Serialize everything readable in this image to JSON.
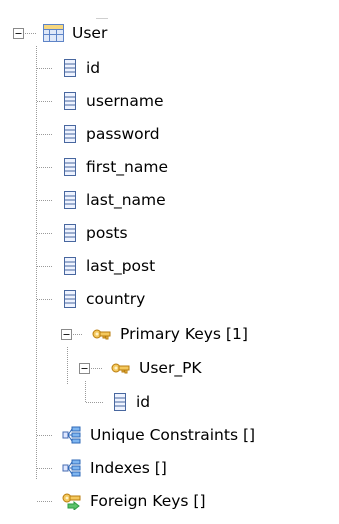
{
  "tree": {
    "table": {
      "label": "User",
      "icon": "table-grid-icon"
    },
    "columns": [
      {
        "label": "id",
        "icon": "column-icon"
      },
      {
        "label": "username",
        "icon": "column-icon"
      },
      {
        "label": "password",
        "icon": "column-icon"
      },
      {
        "label": "first_name",
        "icon": "column-icon"
      },
      {
        "label": "last_name",
        "icon": "column-icon"
      },
      {
        "label": "posts",
        "icon": "column-icon"
      },
      {
        "label": "last_post",
        "icon": "column-icon"
      },
      {
        "label": "country",
        "icon": "column-icon"
      }
    ],
    "primary_keys": {
      "label": "Primary Keys [1]",
      "icon": "key-icon",
      "child": {
        "label": "User_PK",
        "icon": "key-icon",
        "column": {
          "label": "id",
          "icon": "column-icon"
        }
      }
    },
    "unique_constraints": {
      "label": "Unique Constraints []",
      "icon": "constraint-icon"
    },
    "indexes": {
      "label": "Indexes []",
      "icon": "index-icon"
    },
    "foreign_keys": {
      "label": "Foreign Keys []",
      "icon": "foreign-key-icon"
    }
  },
  "colors": {
    "grid_blue": "#5e84c7",
    "column_blue": "#48679f",
    "key_gold": "#d79b18",
    "index_blue": "#3a8ad1",
    "fk_green": "#2e9c43"
  }
}
